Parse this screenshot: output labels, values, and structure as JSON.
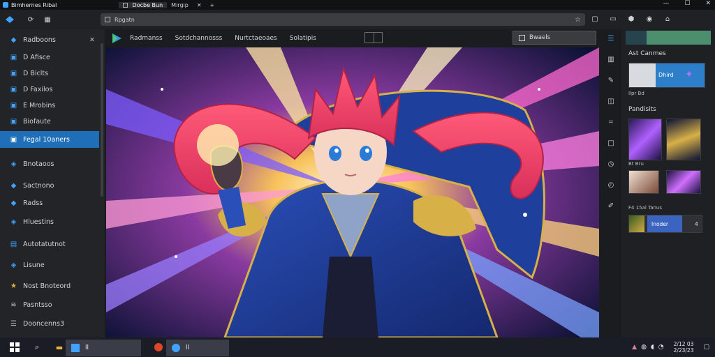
{
  "window": {
    "title": "Bimhernes Ribal",
    "tabs": [
      {
        "label": "Docbe Bun",
        "active": true
      },
      {
        "label": "Mirgip",
        "active": false
      }
    ],
    "close_tab_glyph": "✕",
    "new_tab_glyph": "+"
  },
  "toolbar": {
    "address_text": "Rpgatn",
    "icons": [
      "shield-icon",
      "refresh-icon",
      "grid-icon"
    ],
    "right_icons": [
      "profile-icon",
      "layout-icon",
      "camera-icon",
      "copilot-icon",
      "account-icon"
    ]
  },
  "sidebar": {
    "items": [
      {
        "label": "Radboons",
        "icon": "folder-icon"
      },
      {
        "label": "D Afisce",
        "icon": "file-icon"
      },
      {
        "label": "D Biclts",
        "icon": "file-icon"
      },
      {
        "label": "D Faxilos",
        "icon": "file-icon"
      },
      {
        "label": "E Mrobins",
        "icon": "file-icon"
      },
      {
        "label": "Biofaute",
        "icon": "file-icon"
      },
      {
        "label": "Fegal 10aners",
        "icon": "image-icon",
        "selected": true
      },
      {
        "label": "Bnotaoos",
        "icon": "tag-icon"
      },
      {
        "label": "Sactnono",
        "icon": "folder-icon"
      },
      {
        "label": "Radss",
        "icon": "folder-icon"
      },
      {
        "label": "Hluestins",
        "icon": "tag-icon"
      },
      {
        "label": "Autotatutnot",
        "icon": "chart-icon"
      },
      {
        "label": "Lisune",
        "icon": "tag-icon"
      },
      {
        "label": "Nost Bnoteord",
        "icon": "star-icon"
      },
      {
        "label": "Pasntsso",
        "icon": "stack-icon"
      },
      {
        "label": "Dooncenns3",
        "icon": "list-icon"
      }
    ]
  },
  "app_menu": {
    "items": [
      "Radmanss",
      "Sotdchannosss",
      "Nurtctaeoaes",
      "Solatipis"
    ],
    "panel_button": "Bwaels"
  },
  "right_panel": {
    "section1": "Ast Canmes",
    "thumb1_caption": "Dhird",
    "thumb1_sub": "Ilpr  Bd",
    "section2": "Pandisits",
    "grid_caption1": "Bt    Bru",
    "grid_caption2": "F4 15al  Tanus",
    "strip_caption": "Inoder",
    "strip_badge": "4"
  },
  "taskbar": {
    "task1_label": "ll",
    "task2_label": "ll",
    "clock_time": "2/12 03",
    "clock_date": "2/23/23"
  },
  "colors": {
    "accent": "#1e6fb8",
    "icon_blue": "#3fa3ff"
  }
}
